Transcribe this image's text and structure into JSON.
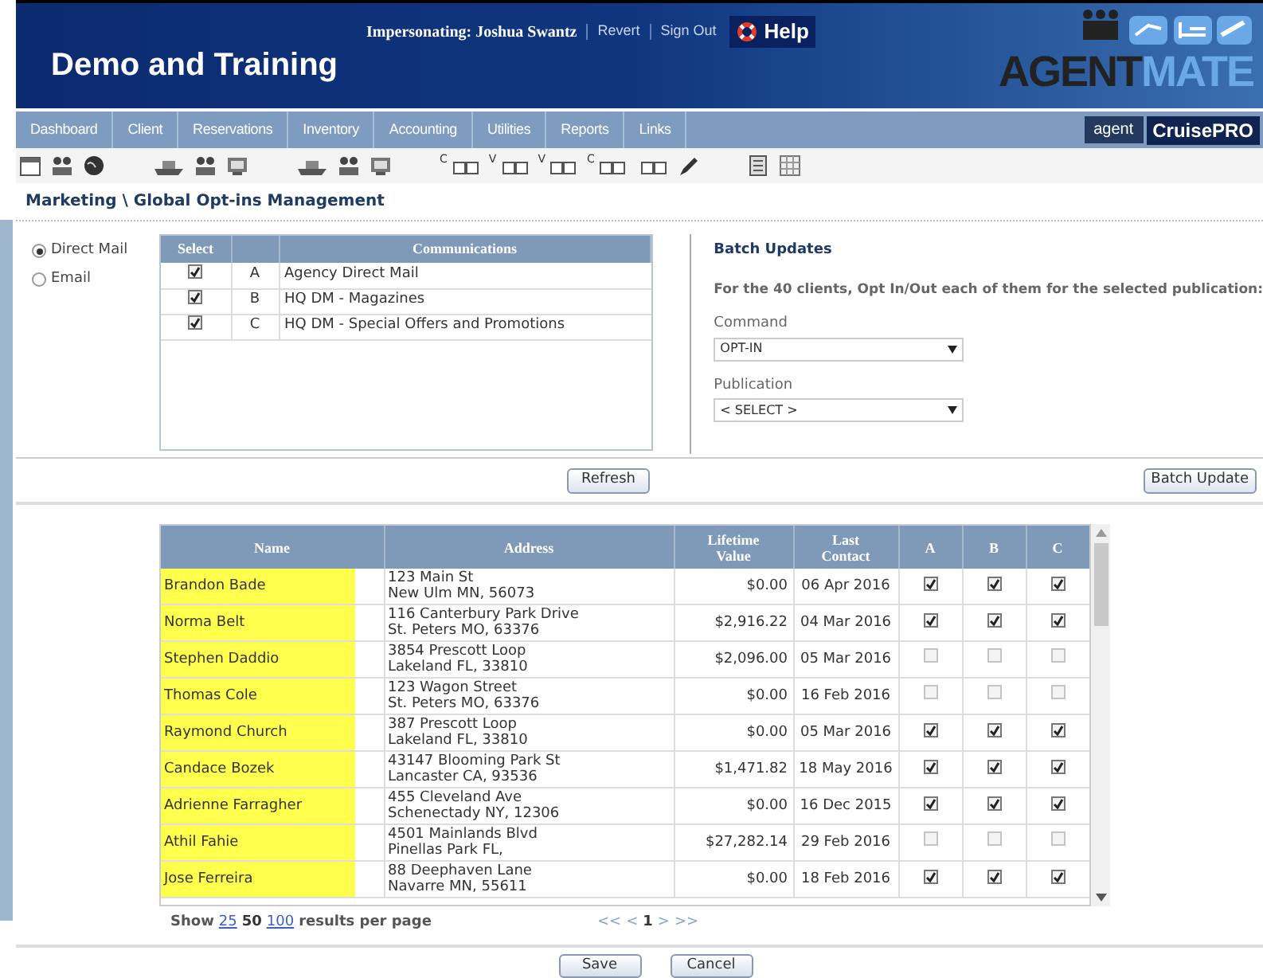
{
  "header": {
    "title": "Demo and Training",
    "impersonating": "Impersonating: Joshua Swantz",
    "links": [
      "Revert",
      "Sign Out"
    ],
    "help": "Help",
    "logo": {
      "part_1": "AGENT",
      "part_2": "MATE"
    }
  },
  "nav": {
    "items": [
      {
        "label": "Dashboard"
      },
      {
        "label": "Client"
      },
      {
        "label": "Reservations"
      },
      {
        "label": "Inventory"
      },
      {
        "label": "Accounting"
      },
      {
        "label": "Utilities"
      },
      {
        "label": "Reports"
      },
      {
        "label": "Links"
      }
    ],
    "partner_logos": [
      {
        "text": "agent"
      },
      {
        "text": "CruisePRO"
      }
    ]
  },
  "toolbar": [
    {
      "kind": "window"
    },
    {
      "kind": "people"
    },
    {
      "kind": "globe"
    },
    {
      "kind": "gap"
    },
    {
      "kind": "ship"
    },
    {
      "kind": "people"
    },
    {
      "kind": "screen"
    },
    {
      "kind": "gap"
    },
    {
      "kind": "ship"
    },
    {
      "kind": "people"
    },
    {
      "kind": "screen"
    },
    {
      "kind": "gap"
    },
    {
      "kind": "cards",
      "letter": "C"
    },
    {
      "kind": "cards",
      "letter": "V"
    },
    {
      "kind": "cards",
      "letter": "V"
    },
    {
      "kind": "cards",
      "letter": "C"
    },
    {
      "kind": "cards"
    },
    {
      "kind": "pencil"
    },
    {
      "kind": "gap"
    },
    {
      "kind": "doc"
    },
    {
      "kind": "grid"
    }
  ],
  "breadcrumb": "Marketing \\ Global Opt-ins Management",
  "channels": [
    {
      "label": "Direct Mail",
      "selected": true
    },
    {
      "label": "Email",
      "selected": false
    }
  ],
  "communications": {
    "columns": [
      "Select",
      "",
      "Communications"
    ],
    "rows": [
      {
        "checked": true,
        "code": "A",
        "name": "Agency Direct Mail"
      },
      {
        "checked": true,
        "code": "B",
        "name": "HQ DM - Magazines"
      },
      {
        "checked": true,
        "code": "C",
        "name": "HQ DM - Special Offers and Promotions"
      }
    ]
  },
  "refresh_button": "Refresh",
  "batch": {
    "title": "Batch Updates",
    "sentence": "For the **40** clients, Opt In/Out each of them for the selected publication:",
    "command_label": "Command",
    "command_value": "OPT-IN",
    "publication_label": "Publication",
    "publication_value": "< SELECT >",
    "button": "Batch Update"
  },
  "clients": {
    "columns": [
      "Name",
      "Address",
      "Lifetime Value",
      "Last Contact",
      "A",
      "B",
      "C"
    ],
    "rows": [
      {
        "name": "Brandon Bade",
        "address": [
          "123 Main St",
          "New Ulm MN, 56073"
        ],
        "value": "$0.00",
        "last_contact": "06 Apr 2016",
        "a": true,
        "b": true,
        "c": true
      },
      {
        "name": "Norma Belt",
        "address": [
          "116 Canterbury Park Drive",
          "St. Peters MO, 63376"
        ],
        "value": "$2,916.22",
        "last_contact": "04 Mar 2016",
        "a": true,
        "b": true,
        "c": true
      },
      {
        "name": "Stephen Daddio",
        "address": [
          "3854 Prescott Loop",
          "Lakeland FL, 33810"
        ],
        "value": "$2,096.00",
        "last_contact": "05 Mar 2016",
        "a": false,
        "b": false,
        "c": false
      },
      {
        "name": "Thomas Cole",
        "address": [
          "123 Wagon Street",
          "St. Peters MO, 63376"
        ],
        "value": "$0.00",
        "last_contact": "16 Feb 2016",
        "a": false,
        "b": false,
        "c": false
      },
      {
        "name": "Raymond Church",
        "address": [
          "387 Prescott Loop",
          "Lakeland FL, 33810"
        ],
        "value": "$0.00",
        "last_contact": "05 Mar 2016",
        "a": true,
        "b": true,
        "c": true
      },
      {
        "name": "Candace Bozek",
        "address": [
          "43147 Blooming Park St",
          "Lancaster CA, 93536"
        ],
        "value": "$1,471.82",
        "last_contact": "18 May 2016",
        "a": true,
        "b": true,
        "c": true
      },
      {
        "name": "Adrienne Farragher",
        "address": [
          "455 Cleveland Ave",
          "Schenectady NY, 12306"
        ],
        "value": "$0.00",
        "last_contact": "16 Dec 2015",
        "a": true,
        "b": true,
        "c": true
      },
      {
        "name": "Athil Fahie",
        "address": [
          "4501 Mainlands Blvd",
          "Pinellas Park FL,"
        ],
        "value": "$27,282.14",
        "last_contact": "29 Feb 2016",
        "a": false,
        "b": false,
        "c": false
      },
      {
        "name": "Jose Ferreira",
        "address": [
          "88 Deephaven Lane",
          "Navarre MN, 55611"
        ],
        "value": "$0.00",
        "last_contact": "18 Feb 2016",
        "a": true,
        "b": true,
        "c": true
      }
    ]
  },
  "page_size": {
    "show": "Show",
    "options": [
      {
        "label": "25",
        "selected": false
      },
      {
        "label": "50",
        "selected": true
      },
      {
        "label": "100",
        "selected": false
      }
    ],
    "suffix": "results per page"
  },
  "pager": {
    "first": "<<",
    "prev": "<",
    "current": "1",
    "next": ">",
    "last": ">>"
  },
  "buttons": [
    "Save",
    "Cancel"
  ]
}
